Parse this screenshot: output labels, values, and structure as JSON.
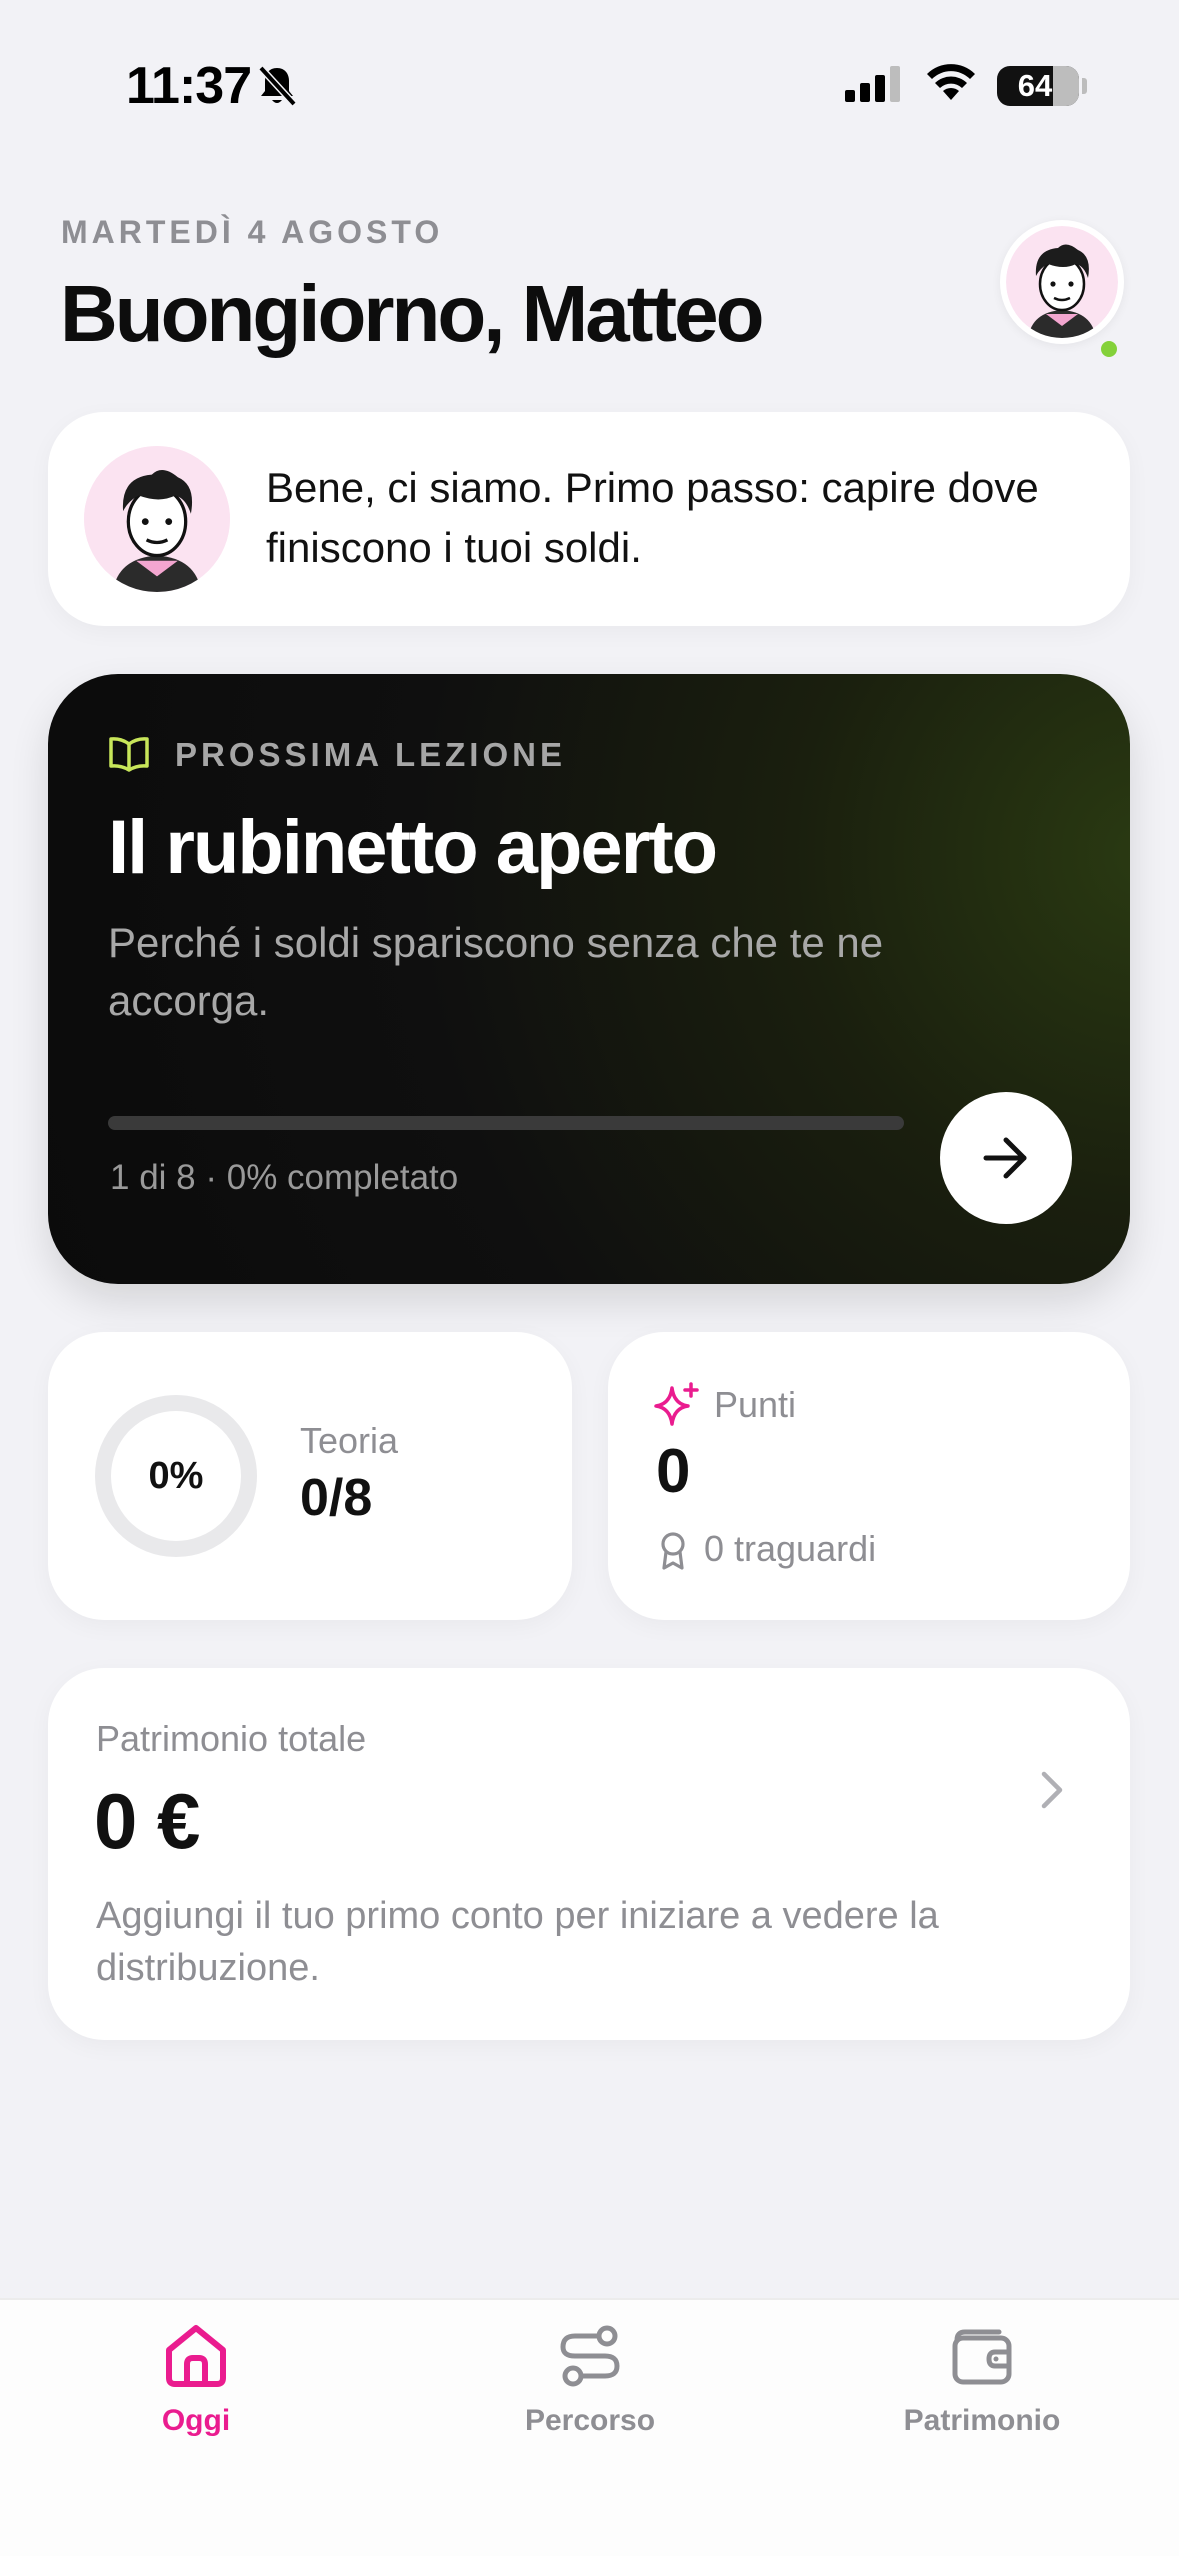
{
  "status_bar": {
    "time": "11:37",
    "battery": "64",
    "icons": [
      "bell-slash-icon",
      "cellular-signal-icon",
      "wifi-icon",
      "battery-icon"
    ]
  },
  "header": {
    "date": "MARTEDÌ 4 AGOSTO",
    "greeting": "Buongiorno, Matteo",
    "online_color": "#84d13a"
  },
  "coach_message": {
    "text": "Bene, ci siamo. Primo passo: capire dove finiscono i tuoi soldi."
  },
  "next_lesson": {
    "label": "PROSSIMA LEZIONE",
    "title": "Il rubinetto aperto",
    "subtitle": "Perché i soldi spariscono senza che te ne accorga.",
    "progress_text": "1 di 8 · 0% completato",
    "progress_fraction": 0,
    "accent_color": "#c8e65a"
  },
  "theory": {
    "ring_label": "0%",
    "ring_fraction": 0,
    "label": "Teoria",
    "value": "0/8"
  },
  "points": {
    "label": "Punti",
    "value": "0",
    "milestones": "0 traguardi",
    "accent_color": "#ea1c8f"
  },
  "net_worth": {
    "label": "Patrimonio totale",
    "value": "0 €",
    "description": "Aggiungi il tuo primo conto per iniziare a vedere la distribuzione."
  },
  "tab_bar": {
    "active_color": "#ea1c8f",
    "inactive_color": "#8e8e93",
    "tabs": [
      {
        "label": "Oggi",
        "icon": "home-icon",
        "active": true
      },
      {
        "label": "Percorso",
        "icon": "route-icon",
        "active": false
      },
      {
        "label": "Patrimonio",
        "icon": "wallet-icon",
        "active": false
      }
    ]
  }
}
